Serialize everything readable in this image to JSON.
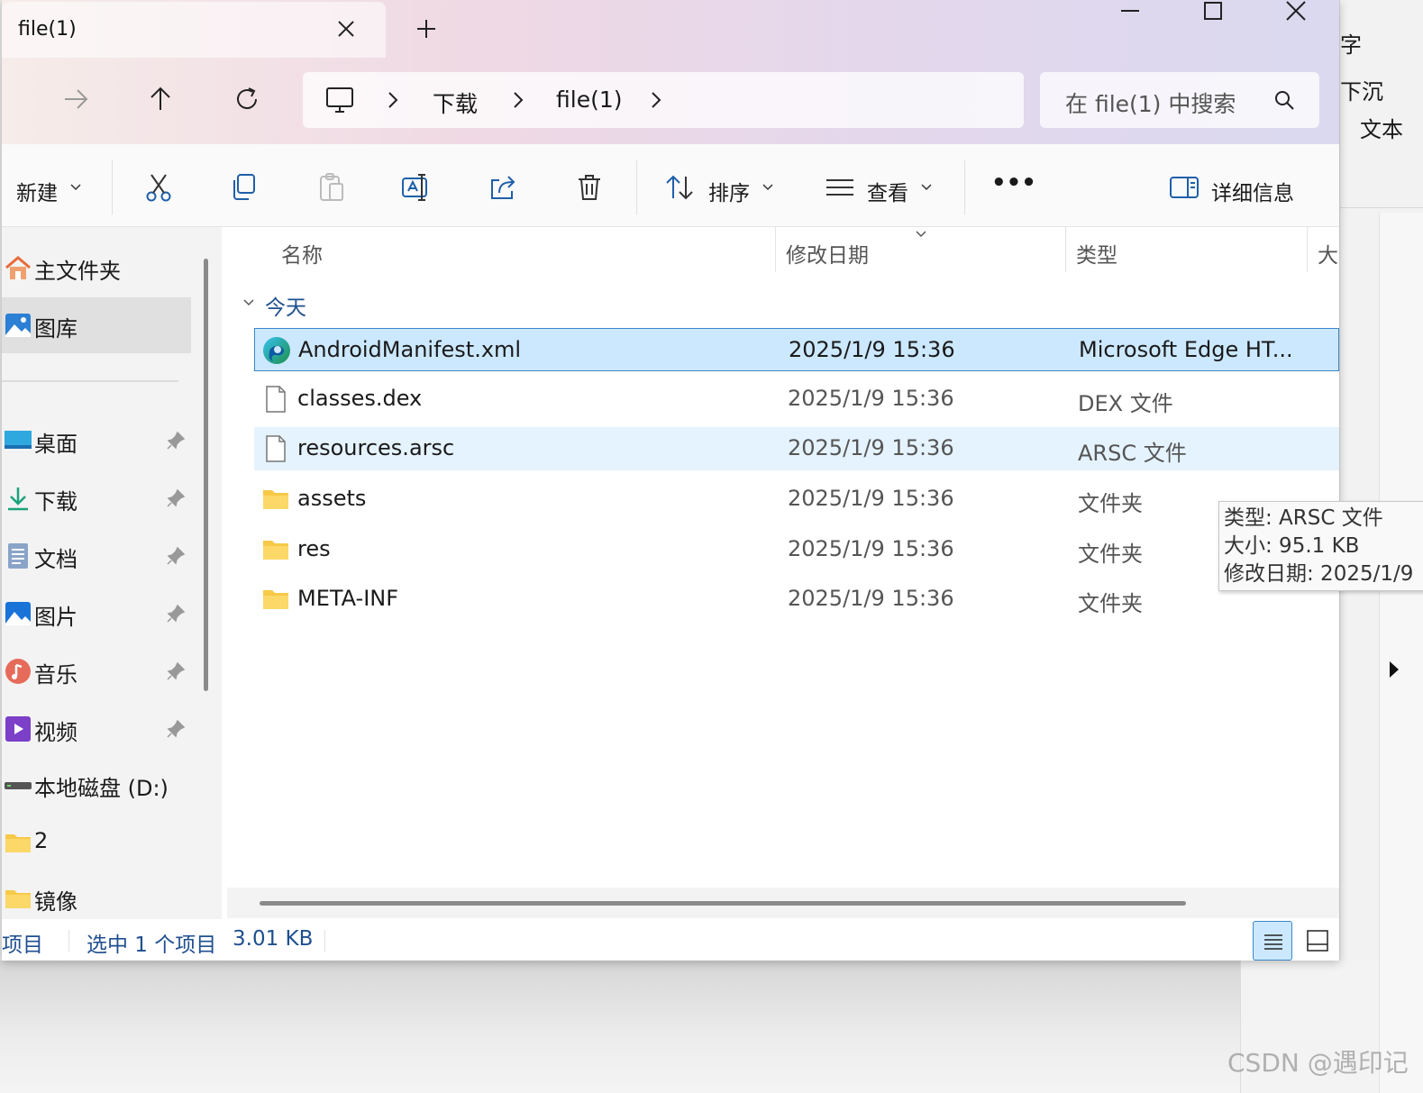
{
  "window": {
    "tab_title": "file(1)",
    "controls": {
      "minimize": "minimize-icon",
      "maximize": "maximize-icon",
      "close": "close-icon"
    }
  },
  "address": {
    "breadcrumb": [
      "下载",
      "file(1)"
    ],
    "search_placeholder": "在 file(1) 中搜索"
  },
  "toolbar": {
    "new_label": "新建",
    "sort_label": "排序",
    "view_label": "查看",
    "more_label": "•••",
    "details_label": "详细信息"
  },
  "sidebar": {
    "top_items": [
      {
        "label": "主文件夹",
        "icon": "home-icon"
      },
      {
        "label": "图库",
        "icon": "gallery-icon"
      }
    ],
    "pinned": [
      {
        "label": "桌面",
        "icon": "desktop-icon"
      },
      {
        "label": "下载",
        "icon": "download-icon"
      },
      {
        "label": "文档",
        "icon": "documents-icon"
      },
      {
        "label": "图片",
        "icon": "pictures-icon"
      },
      {
        "label": "音乐",
        "icon": "music-icon"
      },
      {
        "label": "视频",
        "icon": "video-icon"
      }
    ],
    "other": [
      {
        "label": "本地磁盘 (D:)",
        "icon": "drive-icon"
      },
      {
        "label": "2",
        "icon": "folder-icon"
      },
      {
        "label": "镜像",
        "icon": "folder-icon"
      }
    ]
  },
  "list": {
    "columns": [
      "名称",
      "修改日期",
      "类型",
      "大"
    ],
    "group": "今天",
    "rows": [
      {
        "name": "AndroidManifest.xml",
        "date": "2025/1/9 15:36",
        "type": "Microsoft Edge HT...",
        "icon": "edge-icon",
        "state": "selected"
      },
      {
        "name": "classes.dex",
        "date": "2025/1/9 15:36",
        "type": "DEX 文件",
        "icon": "file-icon",
        "state": "normal"
      },
      {
        "name": "resources.arsc",
        "date": "2025/1/9 15:36",
        "type": "ARSC 文件",
        "icon": "file-icon",
        "state": "hover"
      },
      {
        "name": "assets",
        "date": "2025/1/9 15:36",
        "type": "文件夹",
        "icon": "folder-icon",
        "state": "normal"
      },
      {
        "name": "res",
        "date": "2025/1/9 15:36",
        "type": "文件夹",
        "icon": "folder-icon",
        "state": "normal"
      },
      {
        "name": "META-INF",
        "date": "2025/1/9 15:36",
        "type": "文件夹",
        "icon": "folder-icon",
        "state": "normal"
      }
    ]
  },
  "tooltip": {
    "type_line": "类型: ARSC 文件",
    "size_line": "大小: 95.1 KB",
    "date_line": "修改日期: 2025/1/9"
  },
  "status": {
    "items": "项目",
    "selected": "选中 1 个项目",
    "size": "3.01 KB"
  },
  "background_app": {
    "texts": [
      "字",
      "下沉",
      "文本"
    ]
  },
  "watermark": "CSDN @遇印记",
  "colors": {
    "accent": "#3a88c9",
    "selection": "#cce8ff",
    "hover": "#e5f3ff",
    "folder": "#f7c948"
  }
}
